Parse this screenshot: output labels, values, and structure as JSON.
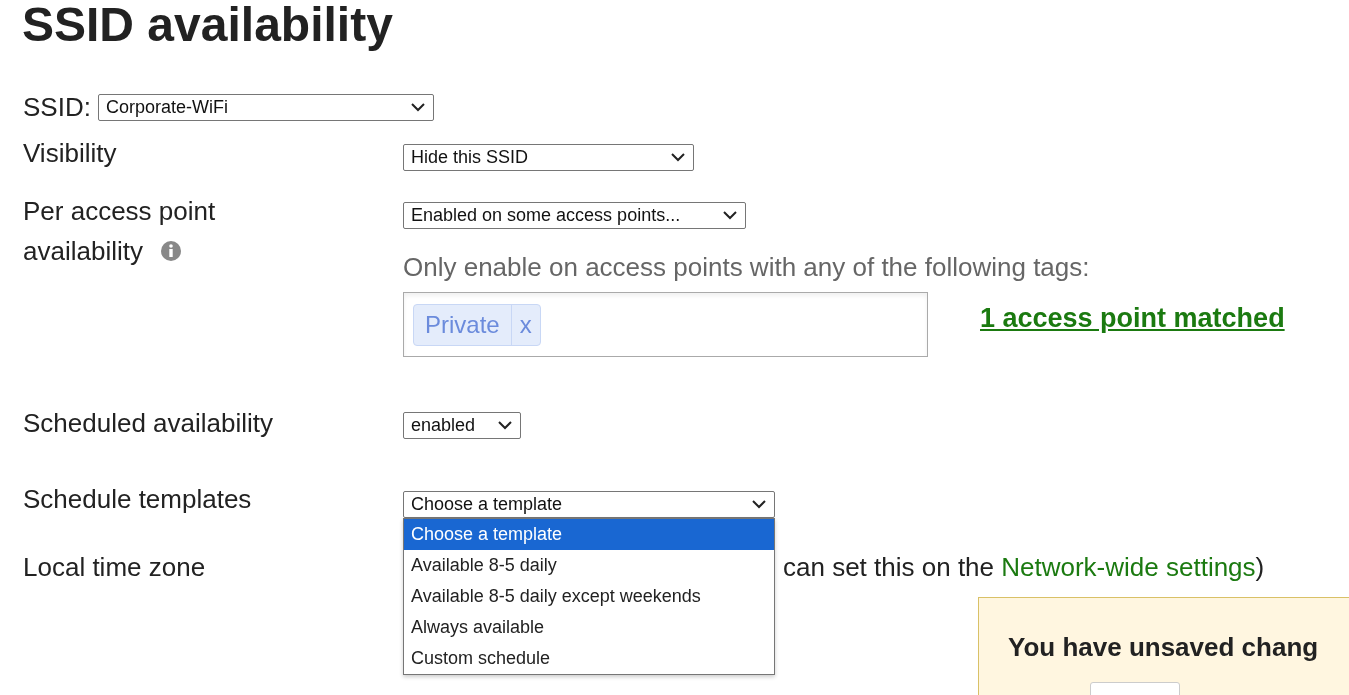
{
  "title": "SSID availability",
  "ssid": {
    "label": "SSID:",
    "value": "Corporate-WiFi"
  },
  "visibility": {
    "label": "Visibility",
    "value": "Hide this SSID"
  },
  "per_ap": {
    "label_lines": [
      "Per access point",
      "availability"
    ],
    "value": "Enabled on some access points...",
    "hint": "Only enable on access points with any of the following tags:",
    "tags": [
      {
        "label": "Private",
        "remove": "x"
      }
    ],
    "match_link": "1 access point matched"
  },
  "scheduled": {
    "label": "Scheduled availability",
    "value": "enabled"
  },
  "templates": {
    "label": "Schedule templates",
    "value": "Choose a template",
    "expanded": true,
    "options": [
      {
        "label": "Choose a template",
        "selected": true
      },
      {
        "label": "Available 8-5 daily",
        "selected": false
      },
      {
        "label": "Available 8-5 daily except weekends",
        "selected": false
      },
      {
        "label": "Always available",
        "selected": false
      },
      {
        "label": "Custom schedule",
        "selected": false
      }
    ]
  },
  "timezone": {
    "label": "Local time zone",
    "note": "can set this on the",
    "link": "Network-wide settings",
    "note_end": ")"
  },
  "unsaved_panel": {
    "title": "You have unsaved chang"
  }
}
